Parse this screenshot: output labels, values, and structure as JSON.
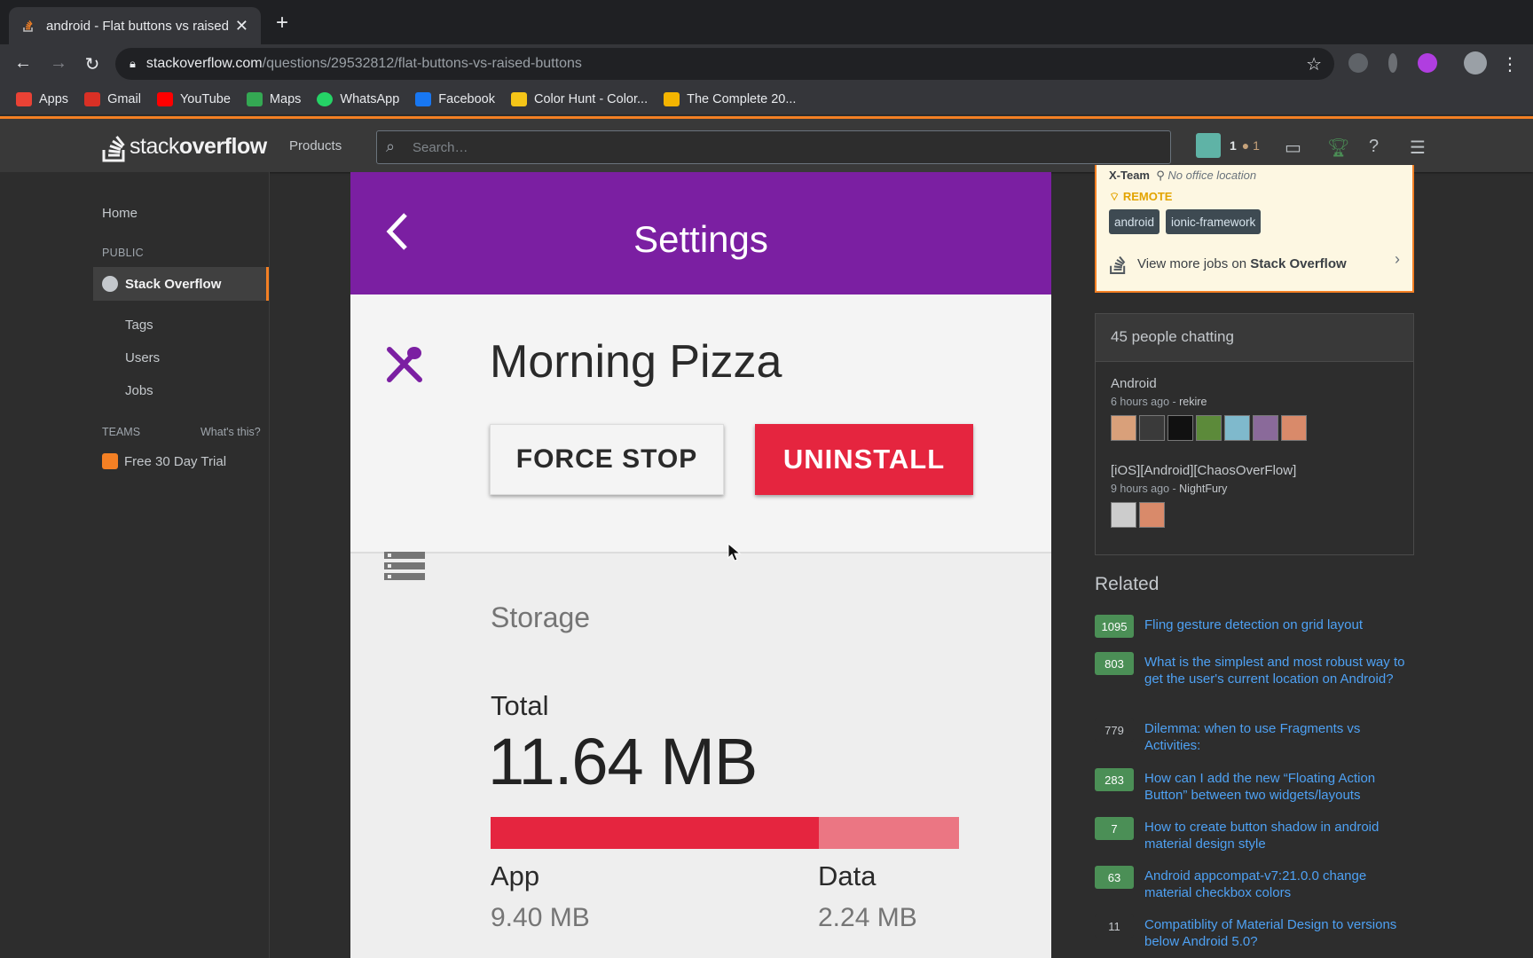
{
  "browser": {
    "tab_title": "android - Flat buttons vs raised",
    "url_host": "stackoverflow.com",
    "url_path": "/questions/29532812/flat-buttons-vs-raised-buttons",
    "bookmarks": [
      {
        "label": "Apps",
        "icon": "apps-grid-icon",
        "color": "#e94235"
      },
      {
        "label": "Gmail",
        "icon": "gmail-icon",
        "color": "#d93025"
      },
      {
        "label": "YouTube",
        "icon": "youtube-icon",
        "color": "#ff0000"
      },
      {
        "label": "Maps",
        "icon": "maps-icon",
        "color": "#34a853"
      },
      {
        "label": "WhatsApp",
        "icon": "whatsapp-icon",
        "color": "#25d366"
      },
      {
        "label": "Facebook",
        "icon": "facebook-icon",
        "color": "#1877f2"
      },
      {
        "label": "Color Hunt - Color...",
        "icon": "colorhunt-icon",
        "color": "#f5c518"
      },
      {
        "label": "The Complete 20...",
        "icon": "course-icon",
        "color": "#f4b400"
      }
    ]
  },
  "so_header": {
    "logo_light": "stack",
    "logo_bold": "overflow",
    "products": "Products",
    "search_placeholder": "Search…",
    "rep": "1",
    "bronze": "1"
  },
  "leftnav": {
    "home": "Home",
    "public": "PUBLIC",
    "stack_overflow": "Stack Overflow",
    "tags": "Tags",
    "users": "Users",
    "jobs": "Jobs",
    "teams": "TEAMS",
    "whats_this": "What's this?",
    "trial": "Free 30 Day Trial"
  },
  "video": {
    "appbar_title": "Settings",
    "app_name": "Morning Pizza",
    "force_stop": "FORCE STOP",
    "uninstall": "UNINSTALL",
    "storage": "Storage",
    "total_label": "Total",
    "total_value": "11.64 MB",
    "app_label": "App",
    "app_value": "9.40 MB",
    "data_label": "Data",
    "data_value": "2.24 MB",
    "app_fraction": 0.7,
    "accent": "#7b1fa2",
    "danger": "#e5253f"
  },
  "jobs_card": {
    "company": "X-Team",
    "location": "No office location",
    "remote": "REMOTE",
    "tags": [
      "android",
      "ionic-framework"
    ],
    "more_prefix": "View more jobs on ",
    "more_bold": "Stack Overflow"
  },
  "chat": {
    "header": "45 people chatting",
    "rooms": [
      {
        "name": "Android",
        "ago": "6 hours ago - ",
        "user": "rekire"
      },
      {
        "name": "[iOS][Android][ChaosOverFlow]",
        "ago": "9 hours ago - ",
        "user": "NightFury"
      }
    ]
  },
  "related": {
    "title": "Related",
    "items": [
      {
        "count": "1095",
        "accepted": true,
        "question": "Fling gesture detection on grid layout"
      },
      {
        "count": "803",
        "accepted": true,
        "question": "What is the simplest and most robust way to get the user's current location on Android?"
      },
      {
        "count": "779",
        "accepted": false,
        "question": "Dilemma: when to use Fragments vs Activities:"
      },
      {
        "count": "283",
        "accepted": true,
        "question": "How can I add the new “Floating Action Button” between two widgets/layouts"
      },
      {
        "count": "7",
        "accepted": true,
        "question": "How to create button shadow in android material design style"
      },
      {
        "count": "63",
        "accepted": true,
        "question": "Android appcompat-v7:21.0.0 change material checkbox colors"
      },
      {
        "count": "11",
        "accepted": false,
        "question": "Compatiblity of Material Design to versions below Android 5.0?"
      }
    ]
  }
}
